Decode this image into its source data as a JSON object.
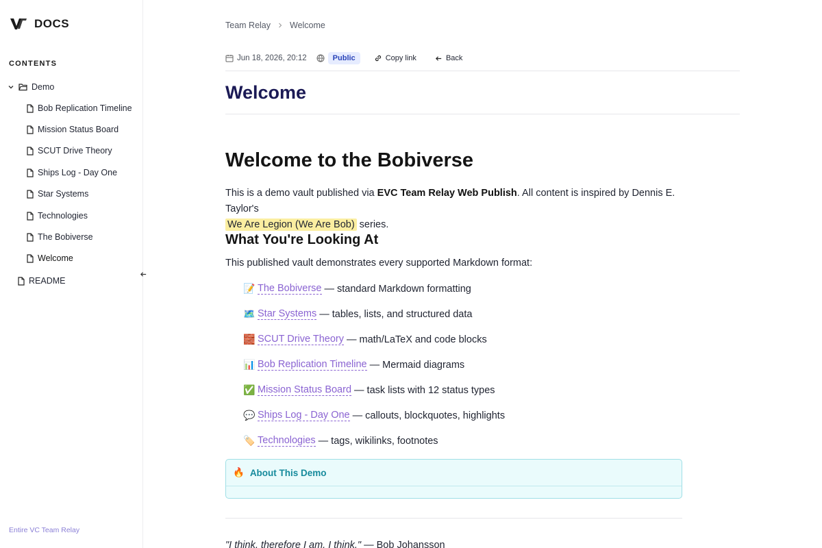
{
  "brand": {
    "name": "DOCS"
  },
  "sidebar": {
    "contents_label": "CONTENTS",
    "folder": {
      "label": "Demo"
    },
    "items": [
      {
        "label": "Bob Replication Timeline"
      },
      {
        "label": "Mission Status Board"
      },
      {
        "label": "SCUT Drive Theory"
      },
      {
        "label": "Ships Log - Day One"
      },
      {
        "label": "Star Systems"
      },
      {
        "label": "Technologies"
      },
      {
        "label": "The Bobiverse"
      },
      {
        "label": "Welcome"
      }
    ],
    "root_items": [
      {
        "label": "README"
      }
    ],
    "footer": "Entire VC Team Relay"
  },
  "breadcrumb": {
    "parent": "Team Relay",
    "current": "Welcome"
  },
  "meta": {
    "date": "Jun 18, 2026, 20:12",
    "visibility": "Public",
    "copy_link": "Copy link",
    "back": "Back"
  },
  "page": {
    "title": "Welcome",
    "heading": "Welcome to the Bobiverse",
    "para_1": "This is a demo vault published via ",
    "para_bold": "EVC Team Relay Web Publish",
    "para_2": ". All content is inspired by Dennis E. Taylor's",
    "para_highlight": "We Are Legion (We Are Bob)",
    "para_3": " series.",
    "subheading": "What You're Looking At",
    "intro": "This published vault demonstrates every supported Markdown format:",
    "list": [
      {
        "emoji": "📝",
        "link": "The Bobiverse",
        "rest": "— standard Markdown formatting"
      },
      {
        "emoji": "🗺️",
        "link": "Star Systems",
        "rest": "— tables, lists, and structured data"
      },
      {
        "emoji": "🧱",
        "link": "SCUT Drive Theory",
        "rest": "— math/LaTeX and code blocks"
      },
      {
        "emoji": "📊",
        "link": "Bob Replication Timeline",
        "rest": "— Mermaid diagrams"
      },
      {
        "emoji": "✅",
        "link": "Mission Status Board",
        "rest": "— task lists with 12 status types"
      },
      {
        "emoji": "💬",
        "link": "Ships Log - Day One",
        "rest": "— callouts, blockquotes, highlights"
      },
      {
        "emoji": "🏷️",
        "link": "Technologies",
        "rest": "— tags, wikilinks, footnotes"
      }
    ],
    "callout": {
      "emoji": "🔥",
      "title": "About This Demo"
    },
    "quote_text": "\"I think, therefore I am. I think.\"",
    "quote_author": " — Bob Johansson"
  },
  "colors": {
    "link": "#8a63d2",
    "title": "#1b1a55",
    "callout": "#168a9c",
    "highlight": "#fbeea0"
  }
}
